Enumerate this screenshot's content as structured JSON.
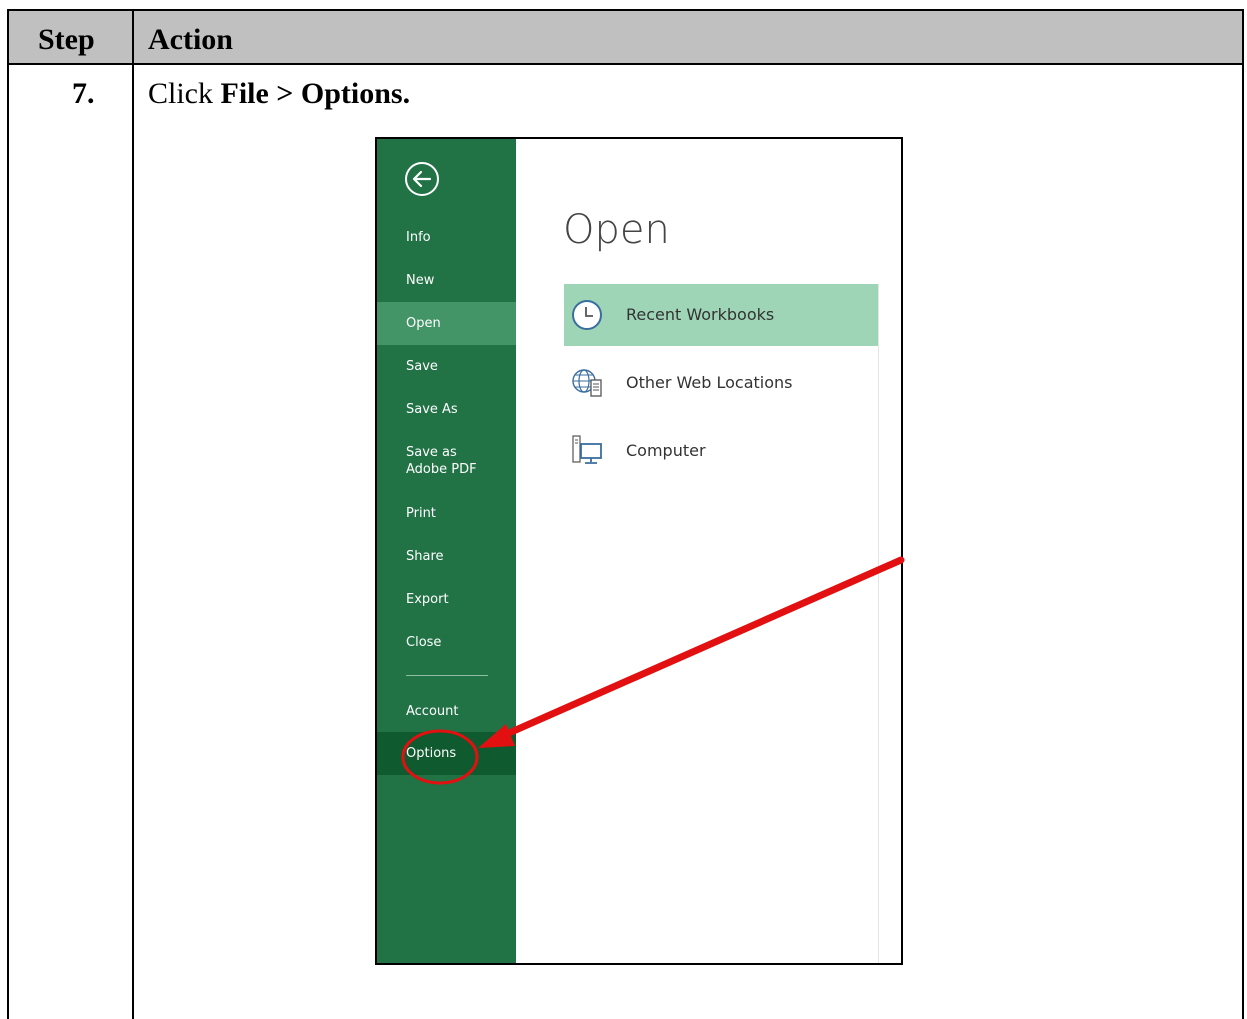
{
  "table": {
    "header_step": "Step",
    "header_action": "Action",
    "step_number": "7.",
    "instruction_prefix": "Click ",
    "instruction_bold": "File > Options."
  },
  "backstage": {
    "back_icon": "back-arrow-circle-icon",
    "items": [
      {
        "label": "Info"
      },
      {
        "label": "New"
      },
      {
        "label": "Open"
      },
      {
        "label": "Save"
      },
      {
        "label": "Save As"
      },
      {
        "label": "Save as Adobe PDF"
      },
      {
        "label": "Print"
      },
      {
        "label": "Share"
      },
      {
        "label": "Export"
      },
      {
        "label": "Close"
      },
      {
        "label": "Account"
      },
      {
        "label": "Options"
      }
    ],
    "selected": "Open",
    "highlighted": "Options"
  },
  "content": {
    "title": "Open",
    "locations": [
      {
        "label": "Recent Workbooks",
        "icon": "clock-icon"
      },
      {
        "label": "Other Web Locations",
        "icon": "globe-server-icon"
      },
      {
        "label": "Computer",
        "icon": "computer-icon"
      }
    ]
  },
  "colors": {
    "backstage": "#217346",
    "selected_item": "#439467",
    "highlighted_item": "#0f5a2e",
    "selected_location": "#9fd5b7",
    "annotation": "#e21010"
  }
}
